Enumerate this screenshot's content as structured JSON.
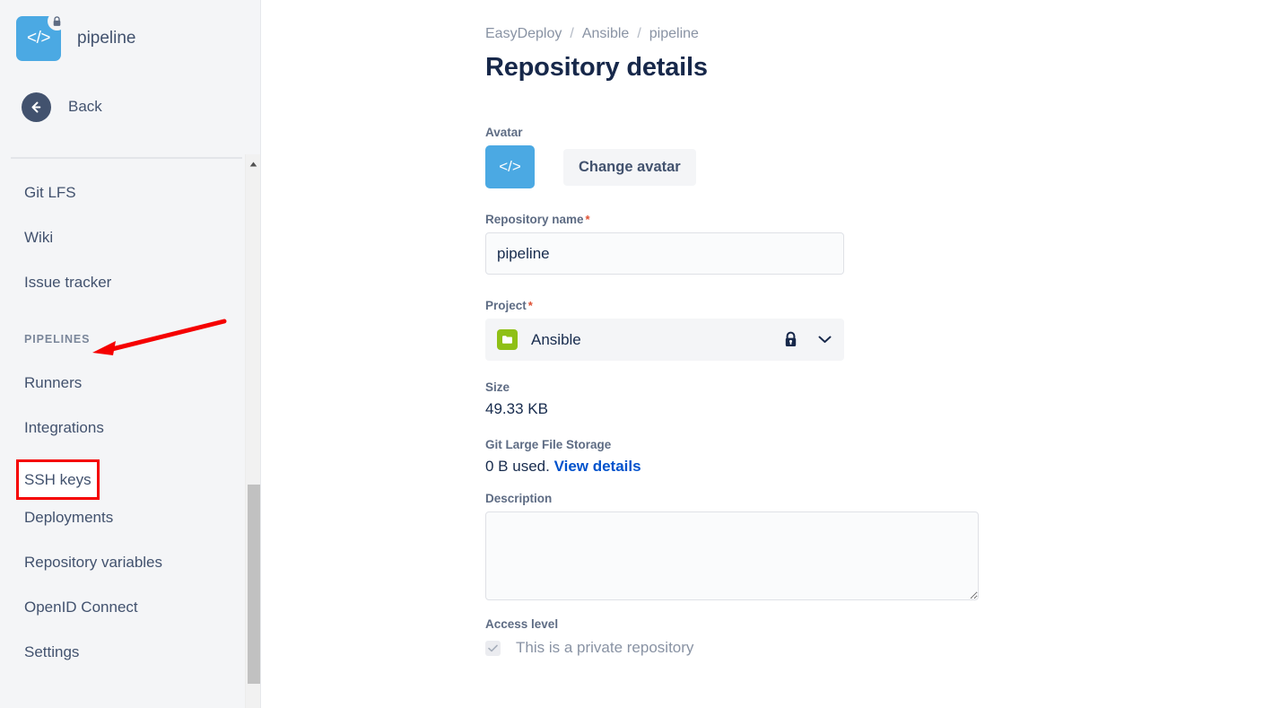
{
  "sidebar": {
    "repo": {
      "name": "pipeline",
      "logo_glyph": "</>",
      "logo_color": "#4ba9e3",
      "badge_icon": "lock-icon"
    },
    "back": {
      "label": "Back",
      "icon": "arrow-left-icon"
    },
    "nav": [
      {
        "type": "item",
        "label": "Git LFS"
      },
      {
        "type": "item",
        "label": "Wiki"
      },
      {
        "type": "item",
        "label": "Issue tracker"
      },
      {
        "type": "section",
        "label": "PIPELINES"
      },
      {
        "type": "item",
        "label": "Runners"
      },
      {
        "type": "item",
        "label": "Integrations"
      },
      {
        "type": "item",
        "label": "SSH keys"
      },
      {
        "type": "item",
        "label": "Deployments"
      },
      {
        "type": "item",
        "label": "Repository variables"
      },
      {
        "type": "item",
        "label": "OpenID Connect"
      },
      {
        "type": "item",
        "label": "Settings"
      }
    ]
  },
  "main": {
    "breadcrumb": [
      "EasyDeploy",
      "Ansible",
      "pipeline"
    ],
    "breadcrumb_separator": "/",
    "title": "Repository details",
    "avatar": {
      "label": "Avatar",
      "glyph": "</>",
      "color": "#4ba9e3",
      "change_button": "Change avatar"
    },
    "repository_name": {
      "label": "Repository name",
      "required_marker": "*",
      "value": "pipeline",
      "placeholder": ""
    },
    "project": {
      "label": "Project",
      "required_marker": "*",
      "value": "Ansible",
      "icon": "project-folder-icon",
      "icon_color": "#8fc016",
      "lock_icon": "lock-icon",
      "chevron_icon": "chevron-down-icon"
    },
    "size": {
      "label": "Size",
      "value": "49.33 KB"
    },
    "git_lfs": {
      "label": "Git Large File Storage",
      "used_text": "0 B used.",
      "link_text": "View details"
    },
    "description": {
      "label": "Description",
      "value": "",
      "placeholder": ""
    },
    "access_level": {
      "label": "Access level",
      "checkbox_label": "This is a private repository",
      "checked": true,
      "disabled": true
    }
  },
  "annotations": {
    "color": "#f50000",
    "arrow": {
      "target": "PIPELINES",
      "direction": "left"
    },
    "highlight_box": {
      "target": "SSH keys",
      "label": "SSH keys"
    }
  }
}
